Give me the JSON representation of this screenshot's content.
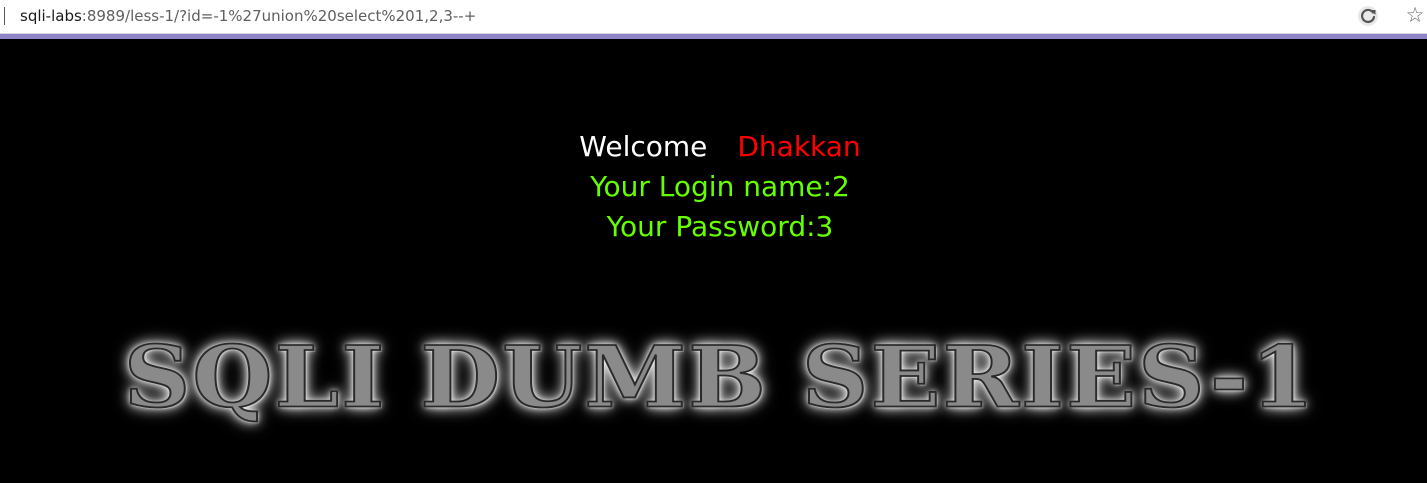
{
  "browser": {
    "url_host": "sqli-labs",
    "url_rest": ":8989/less-1/?id=-1%27union%20select%201,2,3--+",
    "reload_icon": "reload-icon",
    "favorite_icon": "star-icon",
    "favorite_glyph": "☆"
  },
  "page": {
    "welcome": "Welcome",
    "username": "Dhakkan",
    "login_name": "Your Login name:2",
    "password": "Your Password:3",
    "banner": "SQLI DUMB SERIES-1"
  },
  "colors": {
    "background": "#000000",
    "welcome": "#ffffff",
    "username": "#ff0000",
    "result": "#66ff00",
    "accent_line": "#8f85c4"
  }
}
